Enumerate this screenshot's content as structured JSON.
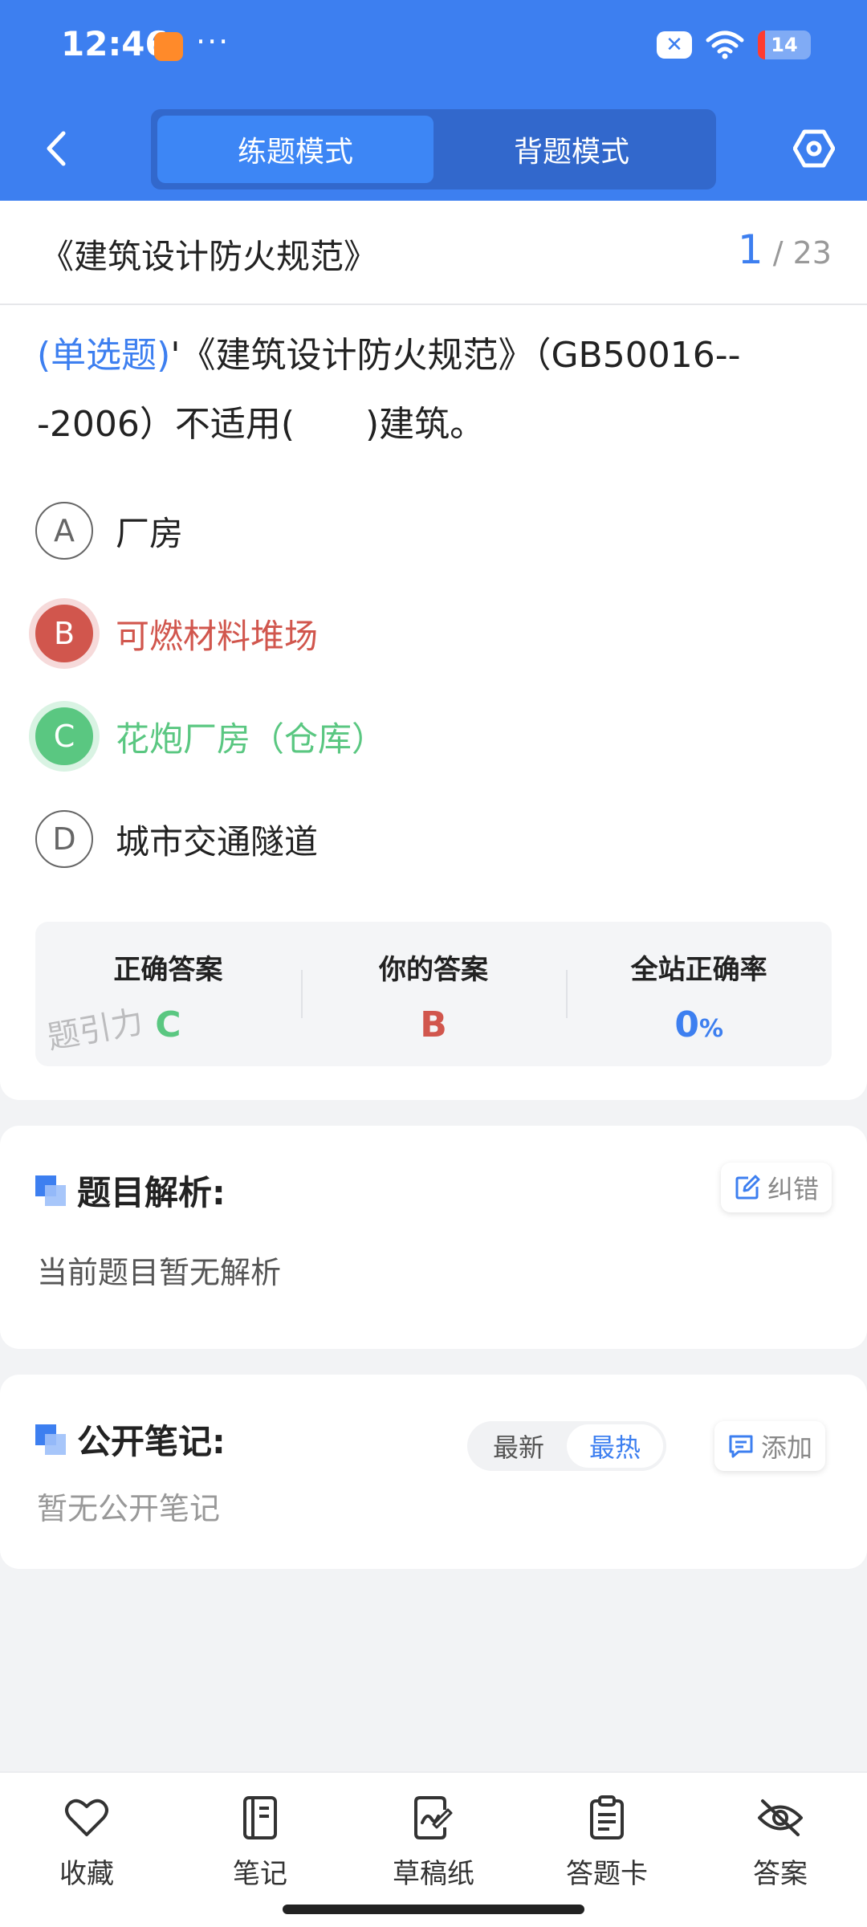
{
  "status_bar": {
    "time": "12:46",
    "dots": "···",
    "nfc_label": "✕",
    "battery_level": "14"
  },
  "header": {
    "tabs": [
      {
        "label": "练题模式",
        "active": true
      },
      {
        "label": "背题模式",
        "active": false
      }
    ]
  },
  "title_bar": {
    "book_title": "《建筑设计防火规范》",
    "current": "1",
    "total": "/ 23"
  },
  "question": {
    "type_label": "(单选题)",
    "text": "'《建筑设计防火规范》（GB50016---2006）不适用(　　)建筑。",
    "options": [
      {
        "letter": "A",
        "text": "厂房",
        "state": "normal"
      },
      {
        "letter": "B",
        "text": "可燃材料堆场",
        "state": "wrong"
      },
      {
        "letter": "C",
        "text": "花炮厂房（仓库）",
        "state": "right"
      },
      {
        "letter": "D",
        "text": "城市交通隧道",
        "state": "normal"
      }
    ]
  },
  "answer_box": {
    "correct_label": "正确答案",
    "correct_value": "C",
    "mine_label": "你的答案",
    "mine_value": "B",
    "rate_label": "全站正确率",
    "rate_value": "0",
    "rate_unit": "%"
  },
  "watermark": "题引力",
  "analysis": {
    "title": "题目解析:",
    "correct_btn": "纠错",
    "body": "当前题目暂无解析"
  },
  "notes": {
    "title": "公开笔记:",
    "sort_options": [
      {
        "label": "最新",
        "active": false
      },
      {
        "label": "最热",
        "active": true
      }
    ],
    "add_btn": "添加",
    "body": "暂无公开笔记"
  },
  "bottom_nav": [
    {
      "label": "收藏",
      "icon": "heart-icon"
    },
    {
      "label": "笔记",
      "icon": "notebook-icon"
    },
    {
      "label": "草稿纸",
      "icon": "draft-paper-icon"
    },
    {
      "label": "答题卡",
      "icon": "answer-sheet-icon"
    },
    {
      "label": "答案",
      "icon": "eye-off-icon"
    }
  ],
  "colors": {
    "primary": "#3d7ff0",
    "wrong": "#d1564d",
    "right": "#5ac781"
  }
}
